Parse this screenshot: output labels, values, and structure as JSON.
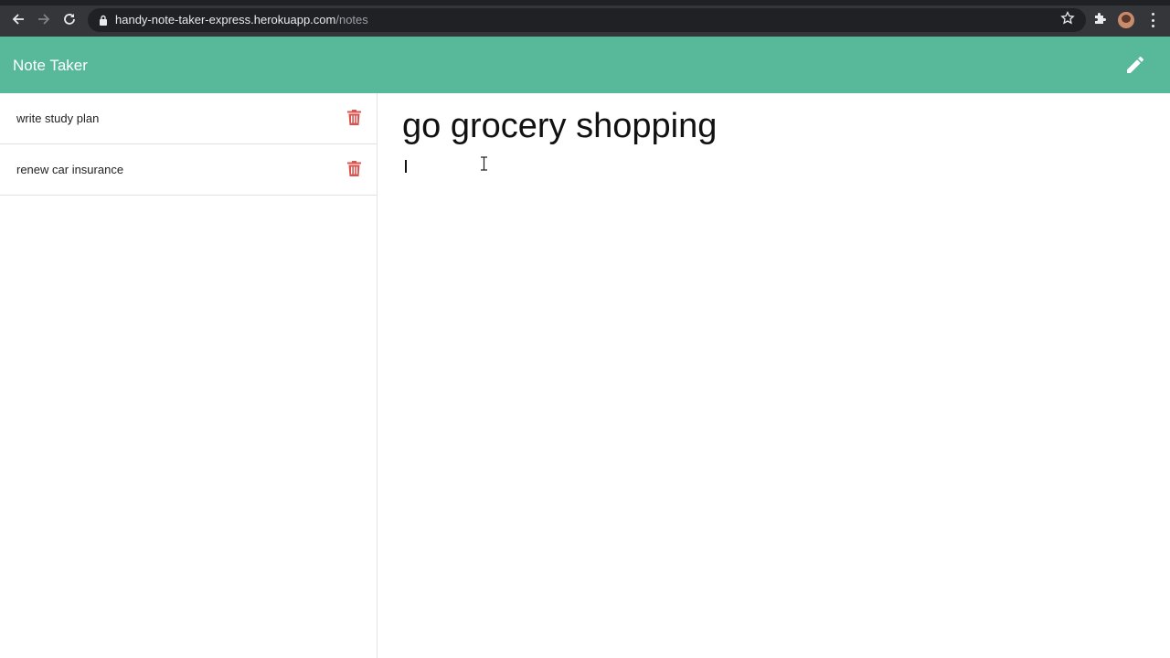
{
  "browser": {
    "url_host": "handy-note-taker-express.herokuapp.com",
    "url_path": "/notes"
  },
  "app": {
    "brand": "Note Taker",
    "accent_color": "#57b99a",
    "delete_color": "#d9534f"
  },
  "notes": [
    {
      "title": "write study plan"
    },
    {
      "title": "renew car insurance"
    }
  ],
  "editor": {
    "title_value": "go grocery shopping",
    "body_value": ""
  },
  "icons": {
    "new_note": "pencil-icon",
    "delete": "trash-icon"
  }
}
